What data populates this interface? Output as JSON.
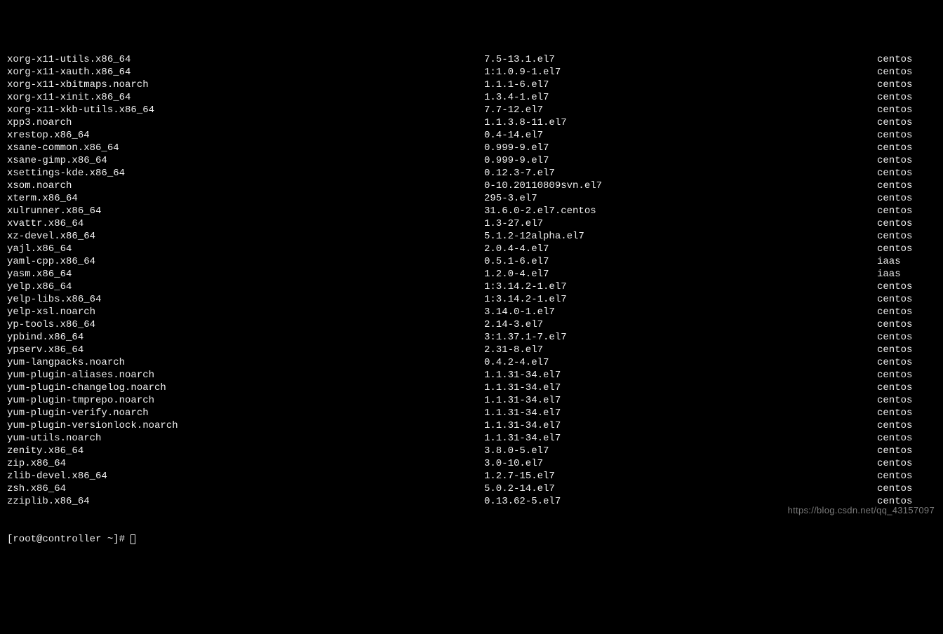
{
  "packages": [
    {
      "name": "xorg-x11-utils.x86_64",
      "version": "7.5-13.1.el7",
      "repo": "centos"
    },
    {
      "name": "xorg-x11-xauth.x86_64",
      "version": "1:1.0.9-1.el7",
      "repo": "centos"
    },
    {
      "name": "xorg-x11-xbitmaps.noarch",
      "version": "1.1.1-6.el7",
      "repo": "centos"
    },
    {
      "name": "xorg-x11-xinit.x86_64",
      "version": "1.3.4-1.el7",
      "repo": "centos"
    },
    {
      "name": "xorg-x11-xkb-utils.x86_64",
      "version": "7.7-12.el7",
      "repo": "centos"
    },
    {
      "name": "xpp3.noarch",
      "version": "1.1.3.8-11.el7",
      "repo": "centos"
    },
    {
      "name": "xrestop.x86_64",
      "version": "0.4-14.el7",
      "repo": "centos"
    },
    {
      "name": "xsane-common.x86_64",
      "version": "0.999-9.el7",
      "repo": "centos"
    },
    {
      "name": "xsane-gimp.x86_64",
      "version": "0.999-9.el7",
      "repo": "centos"
    },
    {
      "name": "xsettings-kde.x86_64",
      "version": "0.12.3-7.el7",
      "repo": "centos"
    },
    {
      "name": "xsom.noarch",
      "version": "0-10.20110809svn.el7",
      "repo": "centos"
    },
    {
      "name": "xterm.x86_64",
      "version": "295-3.el7",
      "repo": "centos"
    },
    {
      "name": "xulrunner.x86_64",
      "version": "31.6.0-2.el7.centos",
      "repo": "centos"
    },
    {
      "name": "xvattr.x86_64",
      "version": "1.3-27.el7",
      "repo": "centos"
    },
    {
      "name": "xz-devel.x86_64",
      "version": "5.1.2-12alpha.el7",
      "repo": "centos"
    },
    {
      "name": "yajl.x86_64",
      "version": "2.0.4-4.el7",
      "repo": "centos"
    },
    {
      "name": "yaml-cpp.x86_64",
      "version": "0.5.1-6.el7",
      "repo": "iaas"
    },
    {
      "name": "yasm.x86_64",
      "version": "1.2.0-4.el7",
      "repo": "iaas"
    },
    {
      "name": "yelp.x86_64",
      "version": "1:3.14.2-1.el7",
      "repo": "centos"
    },
    {
      "name": "yelp-libs.x86_64",
      "version": "1:3.14.2-1.el7",
      "repo": "centos"
    },
    {
      "name": "yelp-xsl.noarch",
      "version": "3.14.0-1.el7",
      "repo": "centos"
    },
    {
      "name": "yp-tools.x86_64",
      "version": "2.14-3.el7",
      "repo": "centos"
    },
    {
      "name": "ypbind.x86_64",
      "version": "3:1.37.1-7.el7",
      "repo": "centos"
    },
    {
      "name": "ypserv.x86_64",
      "version": "2.31-8.el7",
      "repo": "centos"
    },
    {
      "name": "yum-langpacks.noarch",
      "version": "0.4.2-4.el7",
      "repo": "centos"
    },
    {
      "name": "yum-plugin-aliases.noarch",
      "version": "1.1.31-34.el7",
      "repo": "centos"
    },
    {
      "name": "yum-plugin-changelog.noarch",
      "version": "1.1.31-34.el7",
      "repo": "centos"
    },
    {
      "name": "yum-plugin-tmprepo.noarch",
      "version": "1.1.31-34.el7",
      "repo": "centos"
    },
    {
      "name": "yum-plugin-verify.noarch",
      "version": "1.1.31-34.el7",
      "repo": "centos"
    },
    {
      "name": "yum-plugin-versionlock.noarch",
      "version": "1.1.31-34.el7",
      "repo": "centos"
    },
    {
      "name": "yum-utils.noarch",
      "version": "1.1.31-34.el7",
      "repo": "centos"
    },
    {
      "name": "zenity.x86_64",
      "version": "3.8.0-5.el7",
      "repo": "centos"
    },
    {
      "name": "zip.x86_64",
      "version": "3.0-10.el7",
      "repo": "centos"
    },
    {
      "name": "zlib-devel.x86_64",
      "version": "1.2.7-15.el7",
      "repo": "centos"
    },
    {
      "name": "zsh.x86_64",
      "version": "5.0.2-14.el7",
      "repo": "centos"
    },
    {
      "name": "zziplib.x86_64",
      "version": "0.13.62-5.el7",
      "repo": "centos"
    }
  ],
  "prompt": "[root@controller ~]# ",
  "watermark": "https://blog.csdn.net/qq_43157097"
}
